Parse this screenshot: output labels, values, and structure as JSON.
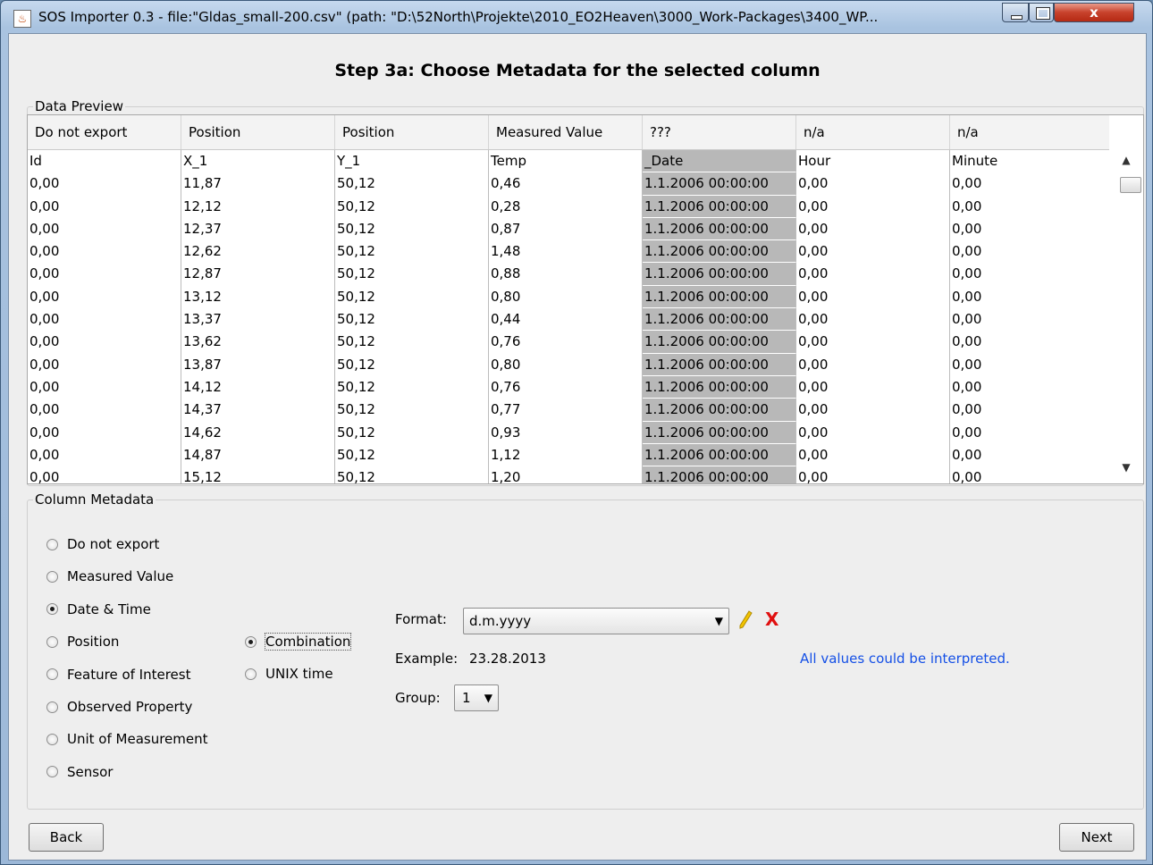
{
  "window": {
    "title": "SOS Importer 0.3 - file:\"Gldas_small-200.csv\" (path: \"D:\\52North\\Projekte\\2010_EO2Heaven\\3000_Work-Packages\\3400_WP...",
    "close_label": "x"
  },
  "step_title": "Step 3a: Choose Metadata for the selected column",
  "data_preview": {
    "legend": "Data Preview",
    "headers": [
      "Do not export",
      "Position",
      "Position",
      "Measured Value",
      "???",
      "n/a",
      "n/a"
    ],
    "rows": [
      [
        "Id",
        "X_1",
        "Y_1",
        "Temp",
        "_Date",
        "Hour",
        "Minute"
      ],
      [
        "0,00",
        "11,87",
        "50,12",
        "0,46",
        "1.1.2006 00:00:00",
        "0,00",
        "0,00"
      ],
      [
        "0,00",
        "12,12",
        "50,12",
        "0,28",
        "1.1.2006 00:00:00",
        "0,00",
        "0,00"
      ],
      [
        "0,00",
        "12,37",
        "50,12",
        "0,87",
        "1.1.2006 00:00:00",
        "0,00",
        "0,00"
      ],
      [
        "0,00",
        "12,62",
        "50,12",
        "1,48",
        "1.1.2006 00:00:00",
        "0,00",
        "0,00"
      ],
      [
        "0,00",
        "12,87",
        "50,12",
        "0,88",
        "1.1.2006 00:00:00",
        "0,00",
        "0,00"
      ],
      [
        "0,00",
        "13,12",
        "50,12",
        "0,80",
        "1.1.2006 00:00:00",
        "0,00",
        "0,00"
      ],
      [
        "0,00",
        "13,37",
        "50,12",
        "0,44",
        "1.1.2006 00:00:00",
        "0,00",
        "0,00"
      ],
      [
        "0,00",
        "13,62",
        "50,12",
        "0,76",
        "1.1.2006 00:00:00",
        "0,00",
        "0,00"
      ],
      [
        "0,00",
        "13,87",
        "50,12",
        "0,80",
        "1.1.2006 00:00:00",
        "0,00",
        "0,00"
      ],
      [
        "0,00",
        "14,12",
        "50,12",
        "0,76",
        "1.1.2006 00:00:00",
        "0,00",
        "0,00"
      ],
      [
        "0,00",
        "14,37",
        "50,12",
        "0,77",
        "1.1.2006 00:00:00",
        "0,00",
        "0,00"
      ],
      [
        "0,00",
        "14,62",
        "50,12",
        "0,93",
        "1.1.2006 00:00:00",
        "0,00",
        "0,00"
      ],
      [
        "0,00",
        "14,87",
        "50,12",
        "1,12",
        "1.1.2006 00:00:00",
        "0,00",
        "0,00"
      ],
      [
        "0,00",
        "15,12",
        "50,12",
        "1,20",
        "1.1.2006 00:00:00",
        "0,00",
        "0,00"
      ]
    ],
    "selected_column": 4
  },
  "column_metadata": {
    "legend": "Column Metadata",
    "options": [
      "Do not export",
      "Measured Value",
      "Date & Time",
      "Position",
      "Feature of Interest",
      "Observed Property",
      "Unit of Measurement",
      "Sensor"
    ],
    "selected_option": "Date & Time",
    "sub_options": [
      "Combination",
      "UNIX time"
    ],
    "selected_sub_option": "Combination",
    "format_label": "Format:",
    "format_value": "d.m.yyyy",
    "example_label": "Example:",
    "example_value": "23.28.2013",
    "group_label": "Group:",
    "group_value": "1",
    "status": "All values could be interpreted.",
    "status_color": "#1550e6",
    "icons": [
      "edit-pencil-icon",
      "delete-x-icon"
    ]
  },
  "buttons": {
    "back": "Back",
    "next": "Next"
  }
}
